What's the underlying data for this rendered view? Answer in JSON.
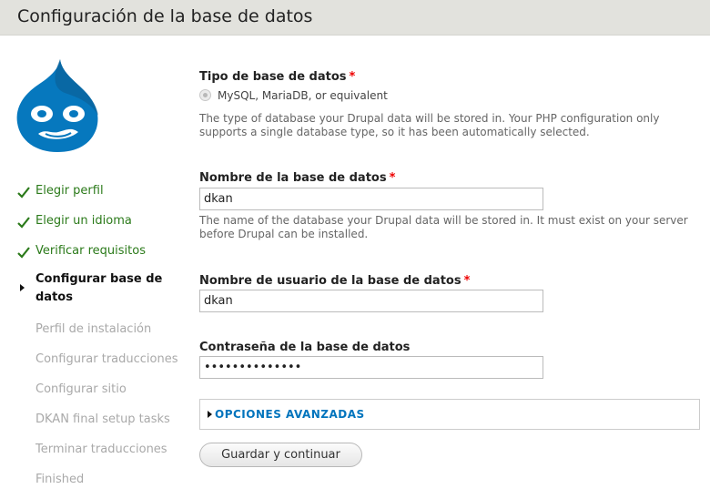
{
  "header": {
    "title": "Configuración de la base de datos"
  },
  "logo": {
    "icon": "drupal-drop-icon",
    "color": "#0678be"
  },
  "sidebar": {
    "steps": [
      {
        "label": "Elegir perfil",
        "state": "done"
      },
      {
        "label": "Elegir un idioma",
        "state": "done"
      },
      {
        "label": "Verificar requisitos",
        "state": "done"
      },
      {
        "label": "Configurar base de datos",
        "state": "active"
      },
      {
        "label": "Perfil de instalación",
        "state": "todo"
      },
      {
        "label": "Configurar traducciones",
        "state": "todo"
      },
      {
        "label": "Configurar sitio",
        "state": "todo"
      },
      {
        "label": "DKAN final setup tasks",
        "state": "todo"
      },
      {
        "label": "Terminar traducciones",
        "state": "todo"
      },
      {
        "label": "Finished",
        "state": "todo"
      }
    ]
  },
  "form": {
    "db_type": {
      "label": "Tipo de base de datos",
      "required": "*",
      "option": "MySQL, MariaDB, or equivalent",
      "description": "The type of database your Drupal data will be stored in. Your PHP configuration only supports a single database type, so it has been automatically selected."
    },
    "db_name": {
      "label": "Nombre de la base de datos",
      "required": "*",
      "value": "dkan",
      "description": "The name of the database your Drupal data will be stored in. It must exist on your server before Drupal can be installed."
    },
    "db_user": {
      "label": "Nombre de usuario de la base de datos",
      "required": "*",
      "value": "dkan"
    },
    "db_pass": {
      "label": "Contraseña de la base de datos",
      "value": "••••••••••••••"
    },
    "advanced": {
      "label": "OPCIONES AVANZADAS"
    },
    "submit": {
      "label": "Guardar y continuar"
    }
  },
  "colors": {
    "done": "#2b7a1a",
    "required": "#ee0000",
    "link": "#0074bd"
  }
}
